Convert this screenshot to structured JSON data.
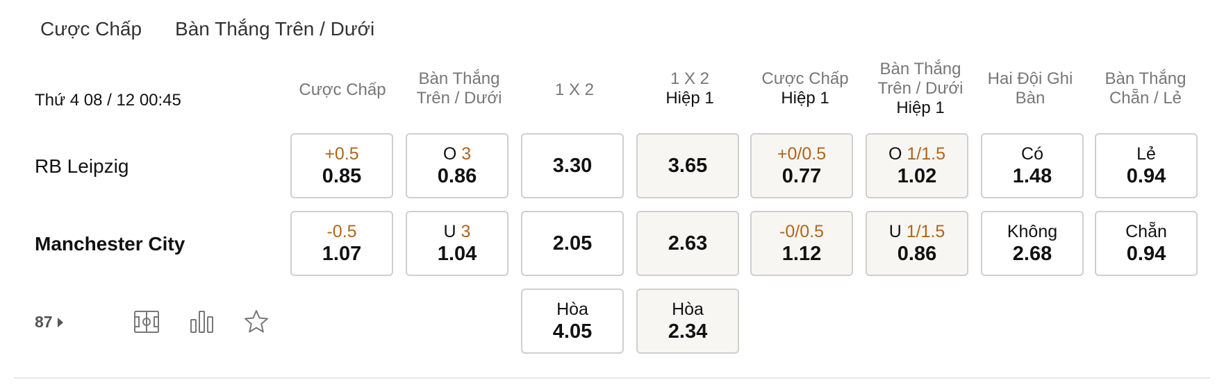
{
  "tabs": [
    "Cược Chấp",
    "Bàn Thắng Trên / Dưới"
  ],
  "match": {
    "datetime": "Thứ 4 08 / 12 00:45",
    "home": "RB Leipzig",
    "away": "Manchester City",
    "more_count": "87"
  },
  "columns": [
    {
      "line1": "Cược Chấp",
      "line2": "",
      "line3": ""
    },
    {
      "line1": "Bàn Thắng",
      "line2": "Trên / Dưới",
      "line3": ""
    },
    {
      "line1": "1 X 2",
      "line2": "",
      "line3": ""
    },
    {
      "line1": "1 X 2",
      "line2": "",
      "line3": "Hiệp 1"
    },
    {
      "line1": "Cược Chấp",
      "line2": "",
      "line3": "Hiệp 1"
    },
    {
      "line1": "Bàn Thắng",
      "line2": "Trên / Dưới",
      "line3": "Hiệp 1"
    },
    {
      "line1": "Hai Đội Ghi",
      "line2": "Bàn",
      "line3": ""
    },
    {
      "line1": "Bàn Thắng",
      "line2": "Chẵn / Lẻ",
      "line3": ""
    }
  ],
  "home_row": [
    {
      "prefix": "",
      "hl": "+0.5",
      "odds": "0.85"
    },
    {
      "prefix": "O ",
      "hl": "3",
      "odds": "0.86"
    },
    {
      "prefix": "",
      "hl": "",
      "odds": "3.30"
    },
    {
      "prefix": "",
      "hl": "",
      "odds": "3.65"
    },
    {
      "prefix": "",
      "hl": "+0/0.5",
      "odds": "0.77"
    },
    {
      "prefix": "O ",
      "hl": "1/1.5",
      "odds": "1.02"
    },
    {
      "prefix": "Có",
      "hl": "",
      "odds": "1.48"
    },
    {
      "prefix": "Lẻ",
      "hl": "",
      "odds": "0.94"
    }
  ],
  "away_row": [
    {
      "prefix": "",
      "hl": "-0.5",
      "odds": "1.07"
    },
    {
      "prefix": "U ",
      "hl": "3",
      "odds": "1.04"
    },
    {
      "prefix": "",
      "hl": "",
      "odds": "2.05"
    },
    {
      "prefix": "",
      "hl": "",
      "odds": "2.63"
    },
    {
      "prefix": "",
      "hl": "-0/0.5",
      "odds": "1.12"
    },
    {
      "prefix": "U ",
      "hl": "1/1.5",
      "odds": "0.86"
    },
    {
      "prefix": "Không",
      "hl": "",
      "odds": "2.68"
    },
    {
      "prefix": "Chẵn",
      "hl": "",
      "odds": "0.94"
    }
  ],
  "draw_row": [
    {
      "prefix": "Hòa",
      "hl": "",
      "odds": "4.05"
    },
    {
      "prefix": "Hòa",
      "hl": "",
      "odds": "2.34"
    }
  ],
  "icons": [
    "pitch-icon",
    "stats-bar-icon",
    "star-icon"
  ],
  "colors": {
    "handicap": "#b0651b",
    "shaded_cell": "#f8f6f2",
    "border": "#cfcfcf"
  }
}
